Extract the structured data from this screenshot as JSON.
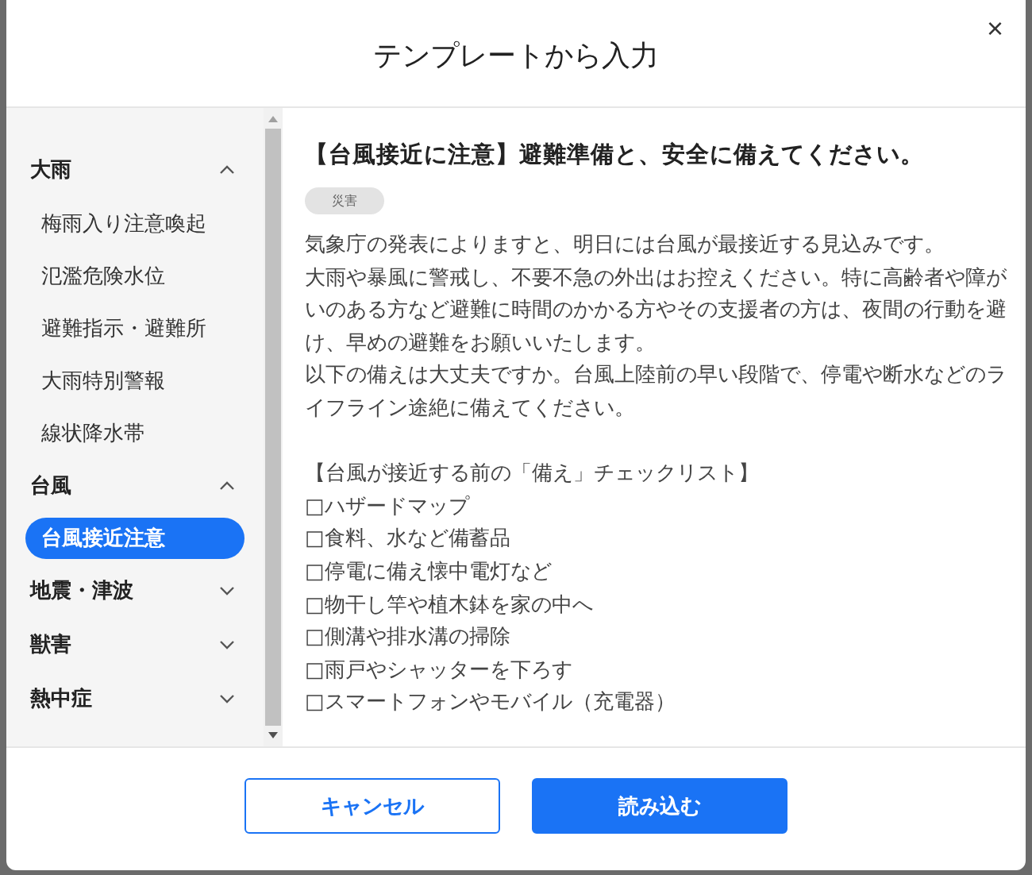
{
  "dialog": {
    "title": "テンプレートから入力",
    "close": "×"
  },
  "sidebar": {
    "groups": [
      {
        "label": "大雨",
        "expanded": true,
        "items": [
          {
            "label": "梅雨入り注意喚起",
            "selected": false
          },
          {
            "label": "氾濫危険水位",
            "selected": false
          },
          {
            "label": "避難指示・避難所",
            "selected": false
          },
          {
            "label": "大雨特別警報",
            "selected": false
          },
          {
            "label": "線状降水帯",
            "selected": false
          }
        ]
      },
      {
        "label": "台風",
        "expanded": true,
        "items": [
          {
            "label": "台風接近注意",
            "selected": true
          }
        ]
      },
      {
        "label": "地震・津波",
        "expanded": false
      },
      {
        "label": "獣害",
        "expanded": false
      },
      {
        "label": "熱中症",
        "expanded": false
      }
    ]
  },
  "template": {
    "title": "【台風接近に注意】避難準備と、安全に備えてください。",
    "tag": "災害",
    "paragraphs": [
      "気象庁の発表によりますと、明日には台風が最接近する見込みです。",
      "大雨や暴風に警戒し、不要不急の外出はお控えください。特に高齢者や障がいのある方など避難に時間のかかる方やその支援者の方は、夜間の行動を避け、早めの避難をお願いいたします。",
      "以下の備えは大丈夫ですか。台風上陸前の早い段階で、停電や断水などのライフライン途絶に備えてください。"
    ],
    "checklist_title": "【台風が接近する前の「備え」チェックリスト】",
    "checklist": [
      "□ハザードマップ",
      "□食料、水など備蓄品",
      "□停電に備え懐中電灯など",
      "□物干し竿や植木鉢を家の中へ",
      "□側溝や排水溝の掃除",
      "□雨戸やシャッターを下ろす",
      "□スマートフォンやモバイル（充電器）"
    ]
  },
  "buttons": [
    {
      "label": "キャンセル",
      "kind": "secondary"
    },
    {
      "label": "読み込む",
      "kind": "primary"
    }
  ]
}
